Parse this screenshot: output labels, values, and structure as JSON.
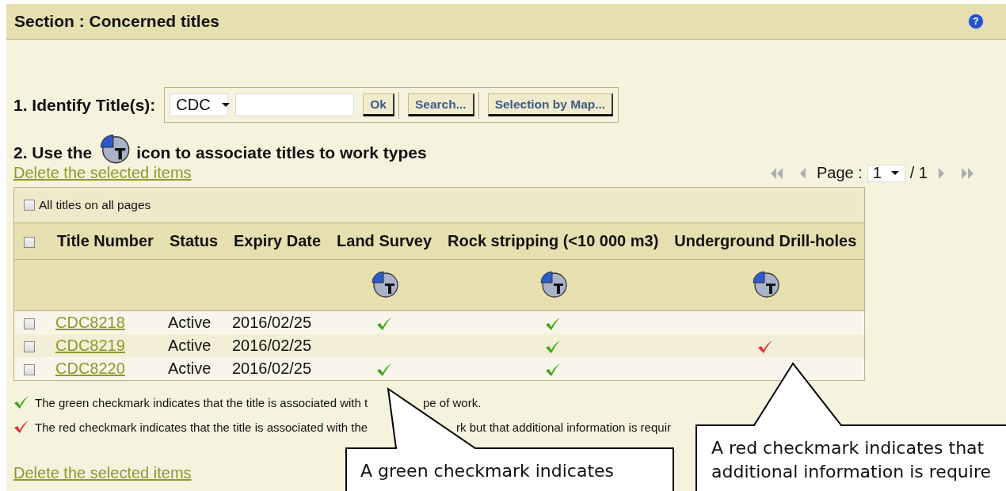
{
  "section": {
    "title": "Section : Concerned titles",
    "help": "?"
  },
  "identify": {
    "label": "1. Identify Title(s):",
    "prefix": "CDC",
    "buttons": [
      "Ok",
      "Search...",
      "Selection by Map..."
    ]
  },
  "step2": {
    "before": "2. Use the",
    "after": "icon to associate titles to work types"
  },
  "delete_link_top": "Delete the selected items",
  "pagination": {
    "label": "Page :",
    "page": "1",
    "total": "/ 1"
  },
  "table": {
    "all_pages": {
      "label": "All titles on all pages",
      "checked": false
    },
    "header_checked": false,
    "columns": [
      "Title Number",
      "Status",
      "Expiry Date",
      "Land Survey",
      "Rock stripping (<10 000 m3)",
      "Underground Drill-holes"
    ],
    "rows": [
      {
        "checked": false,
        "title": "CDC8218",
        "status": "Active",
        "expiry": "2016/02/25",
        "marks": [
          {
            "associated": true,
            "color": "#3aa616"
          },
          {
            "associated": true,
            "color": "#3aa616"
          },
          {
            "associated": false
          }
        ]
      },
      {
        "checked": false,
        "title": "CDC8219",
        "status": "Active",
        "expiry": "2016/02/25",
        "marks": [
          {
            "associated": false
          },
          {
            "associated": true,
            "color": "#3aa616"
          },
          {
            "associated": true,
            "color": "#e0303a"
          }
        ]
      },
      {
        "checked": false,
        "title": "CDC8220",
        "status": "Active",
        "expiry": "2016/02/25",
        "marks": [
          {
            "associated": true,
            "color": "#3aa616"
          },
          {
            "associated": true,
            "color": "#3aa616"
          },
          {
            "associated": false
          }
        ]
      }
    ]
  },
  "legend": [
    {
      "kind": "green",
      "parts": [
        "The green checkmark indicates that the title is associated with t",
        "pe of work."
      ]
    },
    {
      "kind": "red",
      "parts": [
        "The red checkmark indicates that the title is associated with the",
        "rk but that additional information is requir"
      ]
    }
  ],
  "delete_link_bottom": "Delete the selected items",
  "callouts": [
    {
      "lines": [
        "A green checkmark indicates"
      ]
    },
    {
      "lines": [
        "A red checkmark indicates that",
        "additional information is require"
      ]
    }
  ]
}
